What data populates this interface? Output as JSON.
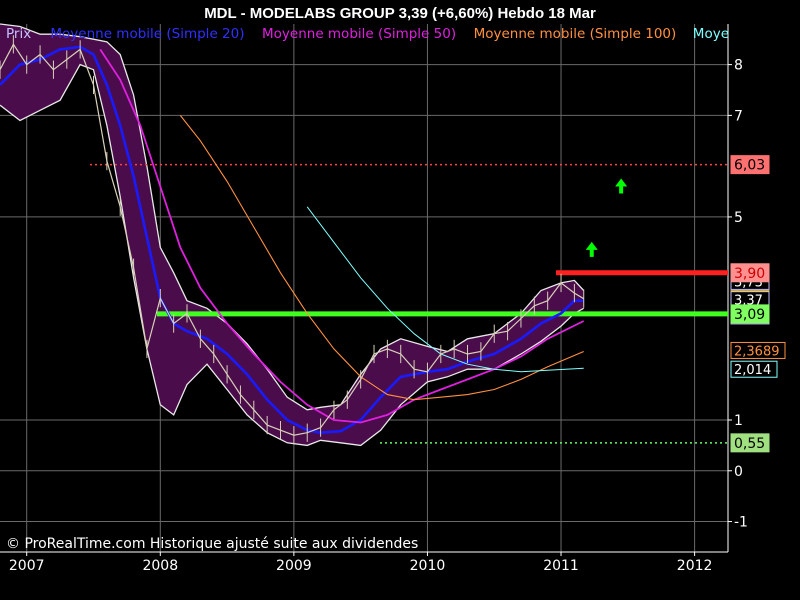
{
  "header": {
    "title": "MDL - MODELABS GROUP     3,39 (+6,60%)     Hebdo  18 Mar"
  },
  "legend": {
    "items": [
      {
        "label": "Prix",
        "color": "#c8c0ff"
      },
      {
        "label": "Moyenne mobile (Simple 20)",
        "color": "#3030ff"
      },
      {
        "label": "Moyenne mobile (Simple 50)",
        "color": "#e020e0"
      },
      {
        "label": "Moyenne mobile (Simple 100)",
        "color": "#ff9040"
      },
      {
        "label": "Moye",
        "color": "#80ffff"
      }
    ]
  },
  "footer": {
    "copyright": "© ProRealTime.com Historique ajusté suite aux dividendes"
  },
  "colors": {
    "background": "#000000",
    "grid": "#6a6a6a",
    "band_fill": "#4a0c4a",
    "price": "#d8d0b8",
    "ma20": "#1a1aff",
    "ma50": "#e020e0",
    "ma100": "#ff9040",
    "ma200": "#80ffff",
    "resistance_red": "#ff2020",
    "support_green": "#40ff20",
    "arrow_green": "#00ff00"
  },
  "chart_data": {
    "type": "line",
    "xlim": [
      2006.8,
      2012.25
    ],
    "ylim": [
      -1.6,
      8.8
    ],
    "x_ticks": [
      {
        "value": 2007,
        "label": "2007"
      },
      {
        "value": 2008,
        "label": "2008"
      },
      {
        "value": 2009,
        "label": "2009"
      },
      {
        "value": 2010,
        "label": "2010"
      },
      {
        "value": 2011,
        "label": "2011"
      },
      {
        "value": 2012,
        "label": "2012"
      }
    ],
    "y_ticks": [
      {
        "value": 8,
        "label": "8"
      },
      {
        "value": 7,
        "label": "7"
      },
      {
        "value": 5,
        "label": "5"
      },
      {
        "value": 1,
        "label": "1"
      },
      {
        "value": 0,
        "label": "0"
      },
      {
        "value": -1,
        "label": "-1"
      }
    ],
    "grid": true,
    "series": [
      {
        "name": "Prix",
        "role": "price",
        "x": [
          2006.8,
          2006.9,
          2007.0,
          2007.1,
          2007.2,
          2007.3,
          2007.4,
          2007.5,
          2007.6,
          2007.7,
          2007.8,
          2007.9,
          2008.0,
          2008.1,
          2008.2,
          2008.3,
          2008.4,
          2008.5,
          2008.6,
          2008.7,
          2008.8,
          2008.9,
          2009.0,
          2009.1,
          2009.2,
          2009.3,
          2009.4,
          2009.5,
          2009.6,
          2009.7,
          2009.8,
          2009.9,
          2010.0,
          2010.1,
          2010.2,
          2010.3,
          2010.4,
          2010.5,
          2010.6,
          2010.7,
          2010.8,
          2010.9,
          2011.0,
          2011.1,
          2011.17
        ],
        "values": [
          7.9,
          8.4,
          8.0,
          8.2,
          7.9,
          8.1,
          8.3,
          7.6,
          6.1,
          5.2,
          4.0,
          2.4,
          3.4,
          2.9,
          3.1,
          2.6,
          2.3,
          1.9,
          1.5,
          1.2,
          0.9,
          0.8,
          0.7,
          0.75,
          0.85,
          1.2,
          1.4,
          1.8,
          2.3,
          2.4,
          2.3,
          2.0,
          1.95,
          2.3,
          2.4,
          2.3,
          2.35,
          2.7,
          2.75,
          3.0,
          3.25,
          3.35,
          3.7,
          3.5,
          3.39
        ]
      },
      {
        "name": "Moyenne mobile (Simple 20)",
        "role": "ma20",
        "x": [
          2006.8,
          2006.95,
          2007.1,
          2007.25,
          2007.4,
          2007.5,
          2007.6,
          2007.7,
          2007.8,
          2007.9,
          2008.0,
          2008.1,
          2008.2,
          2008.35,
          2008.5,
          2008.65,
          2008.8,
          2008.95,
          2009.1,
          2009.2,
          2009.35,
          2009.5,
          2009.65,
          2009.8,
          2010.0,
          2010.15,
          2010.3,
          2010.5,
          2010.7,
          2010.85,
          2011.0,
          2011.1,
          2011.17
        ],
        "values": [
          7.6,
          8.0,
          8.1,
          8.3,
          8.35,
          8.2,
          7.6,
          6.8,
          5.8,
          4.6,
          3.4,
          2.9,
          2.75,
          2.6,
          2.3,
          1.9,
          1.4,
          1.0,
          0.8,
          0.75,
          0.78,
          1.0,
          1.45,
          1.85,
          1.95,
          2.0,
          2.15,
          2.3,
          2.6,
          2.9,
          3.1,
          3.35,
          3.35
        ]
      },
      {
        "name": "Moyenne mobile (Simple 50)",
        "role": "ma50",
        "x": [
          2007.55,
          2007.7,
          2007.85,
          2008.0,
          2008.15,
          2008.3,
          2008.5,
          2008.7,
          2008.9,
          2009.1,
          2009.3,
          2009.5,
          2009.7,
          2009.9,
          2010.1,
          2010.3,
          2010.5,
          2010.7,
          2010.9,
          2011.17
        ],
        "values": [
          8.3,
          7.7,
          6.8,
          5.6,
          4.4,
          3.6,
          2.9,
          2.3,
          1.75,
          1.3,
          1.0,
          0.95,
          1.1,
          1.4,
          1.6,
          1.8,
          2.0,
          2.25,
          2.6,
          2.95
        ]
      },
      {
        "name": "Moyenne mobile (Simple 100)",
        "role": "ma100",
        "x": [
          2008.15,
          2008.3,
          2008.5,
          2008.7,
          2008.9,
          2009.1,
          2009.3,
          2009.5,
          2009.7,
          2009.9,
          2010.1,
          2010.3,
          2010.5,
          2010.7,
          2010.9,
          2011.17
        ],
        "values": [
          7.0,
          6.5,
          5.7,
          4.8,
          3.9,
          3.1,
          2.4,
          1.85,
          1.5,
          1.4,
          1.45,
          1.5,
          1.6,
          1.8,
          2.05,
          2.35
        ]
      },
      {
        "name": "Moye",
        "role": "ma200",
        "x": [
          2009.1,
          2009.3,
          2009.5,
          2009.7,
          2009.9,
          2010.1,
          2010.3,
          2010.5,
          2010.7,
          2010.9,
          2011.17
        ],
        "values": [
          5.2,
          4.5,
          3.8,
          3.2,
          2.7,
          2.3,
          2.1,
          2.0,
          1.95,
          1.98,
          2.02
        ]
      }
    ],
    "band": {
      "name": "bollinger",
      "x": [
        2006.8,
        2006.95,
        2007.1,
        2007.25,
        2007.4,
        2007.5,
        2007.6,
        2007.7,
        2007.8,
        2007.9,
        2008.0,
        2008.1,
        2008.2,
        2008.35,
        2008.5,
        2008.65,
        2008.8,
        2008.95,
        2009.1,
        2009.2,
        2009.35,
        2009.5,
        2009.65,
        2009.8,
        2010.0,
        2010.15,
        2010.3,
        2010.5,
        2010.7,
        2010.85,
        2011.0,
        2011.1,
        2011.17
      ],
      "upper": [
        8.8,
        8.75,
        8.6,
        8.6,
        8.55,
        8.5,
        8.45,
        8.2,
        7.4,
        6.0,
        4.4,
        3.9,
        3.35,
        3.2,
        2.9,
        2.5,
        2.0,
        1.45,
        1.2,
        1.25,
        1.3,
        1.9,
        2.4,
        2.6,
        2.45,
        2.35,
        2.6,
        2.7,
        3.1,
        3.55,
        3.7,
        3.75,
        3.55
      ],
      "lower": [
        7.2,
        6.9,
        7.1,
        7.3,
        8.0,
        7.9,
        6.8,
        5.4,
        3.8,
        2.4,
        1.3,
        1.1,
        1.7,
        2.1,
        1.6,
        1.1,
        0.75,
        0.55,
        0.5,
        0.6,
        0.55,
        0.5,
        0.8,
        1.3,
        1.75,
        1.85,
        2.0,
        2.0,
        2.3,
        2.55,
        2.85,
        3.1,
        3.2
      ]
    },
    "levels": [
      {
        "value": 6.03,
        "label": "6,03",
        "role": "dotted_red",
        "label_bg": "#ff7070",
        "label_fg": "#000000"
      },
      {
        "value": 3.9,
        "label": "3,90",
        "role": "resistance_red",
        "label_bg": "#ff9090",
        "label_fg": "#cc0000"
      },
      {
        "value": 3.09,
        "label": "3,09",
        "role": "support_green",
        "label_bg": "#80ff60",
        "label_fg": "#000000"
      },
      {
        "value": 0.55,
        "label": "0,55",
        "role": "dotted_green",
        "label_bg": "#a0e080",
        "label_fg": "#000000"
      }
    ],
    "axis_value_labels": [
      {
        "value": 3.73,
        "label": "3,73",
        "bg": "#000000",
        "fg": "#ffffff",
        "border": "#c8c0ff"
      },
      {
        "value": 3.39,
        "label": "3,39",
        "bg": "#ffcc00",
        "fg": "#000000",
        "border": "#ffcc00"
      },
      {
        "value": 3.37,
        "label": "3,37",
        "bg": "#000000",
        "fg": "#ffffff",
        "border": "#c8c0ff"
      },
      {
        "value": 3.05,
        "label": "3,05",
        "bg": "#000000",
        "fg": "#ffffff",
        "border": "#c8c0ff"
      },
      {
        "value": 2.37,
        "label": "2,3689",
        "bg": "#000000",
        "fg": "#ff9040",
        "border": "#ff9040"
      },
      {
        "value": 2.0,
        "label": "2,014",
        "bg": "#000000",
        "fg": "#ffffff",
        "border": "#80ffff"
      }
    ],
    "arrows": [
      {
        "x": 2011.45,
        "y": 5.6,
        "direction": "up"
      },
      {
        "x": 2011.23,
        "y": 4.35,
        "direction": "up"
      }
    ]
  }
}
